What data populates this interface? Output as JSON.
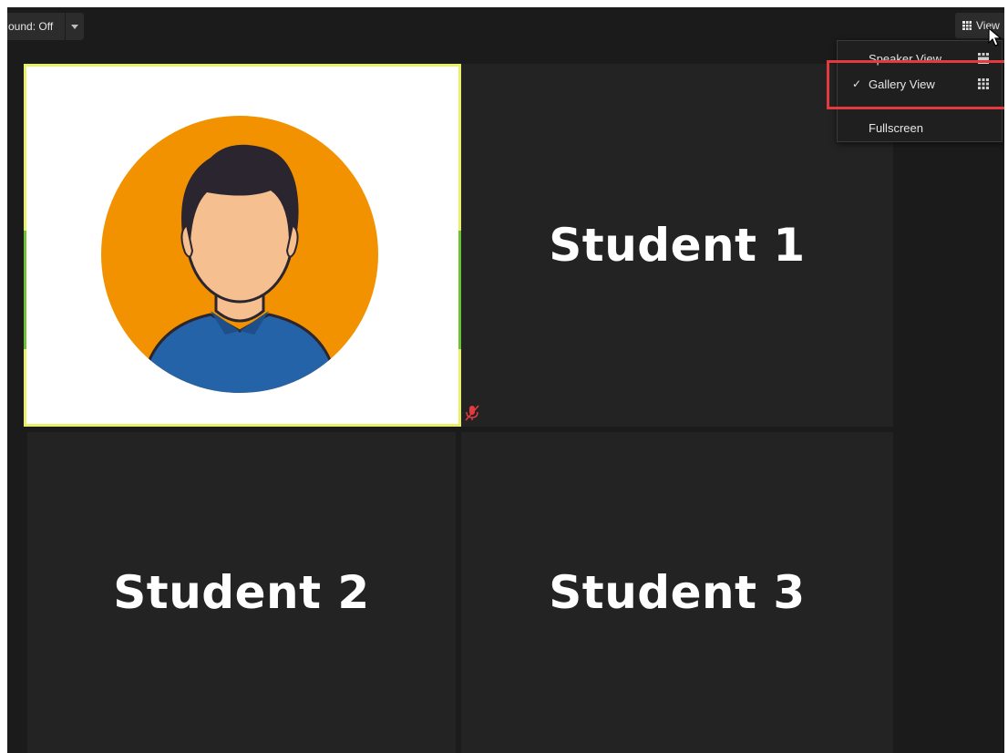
{
  "toolbar": {
    "sound_label": "ound: Off",
    "sound_dropdown_icon": "caret-down-icon",
    "view_label": "View",
    "view_icon": "grid-icon"
  },
  "view_menu": {
    "items": [
      {
        "label": "Speaker View",
        "checked": false,
        "icon": "grid-icon"
      },
      {
        "label": "Gallery View",
        "checked": true,
        "check_glyph": "✓",
        "icon": "grid-icon"
      },
      {
        "label": "Fullscreen",
        "checked": false
      }
    ]
  },
  "gallery": {
    "tiles": [
      {
        "type": "avatar",
        "active_speaker": true
      },
      {
        "name": "Student 1",
        "muted": true
      },
      {
        "name": "Student 2"
      },
      {
        "name": "Student 3"
      }
    ]
  },
  "colors": {
    "background": "#1b1b1b",
    "tile": "#232323",
    "active_border": "#e8f06b",
    "highlight": "#e53940",
    "avatar_circle": "#f39200",
    "avatar_shirt": "#2563a8",
    "avatar_skin": "#f5bf8f",
    "avatar_hair": "#2b2530"
  }
}
